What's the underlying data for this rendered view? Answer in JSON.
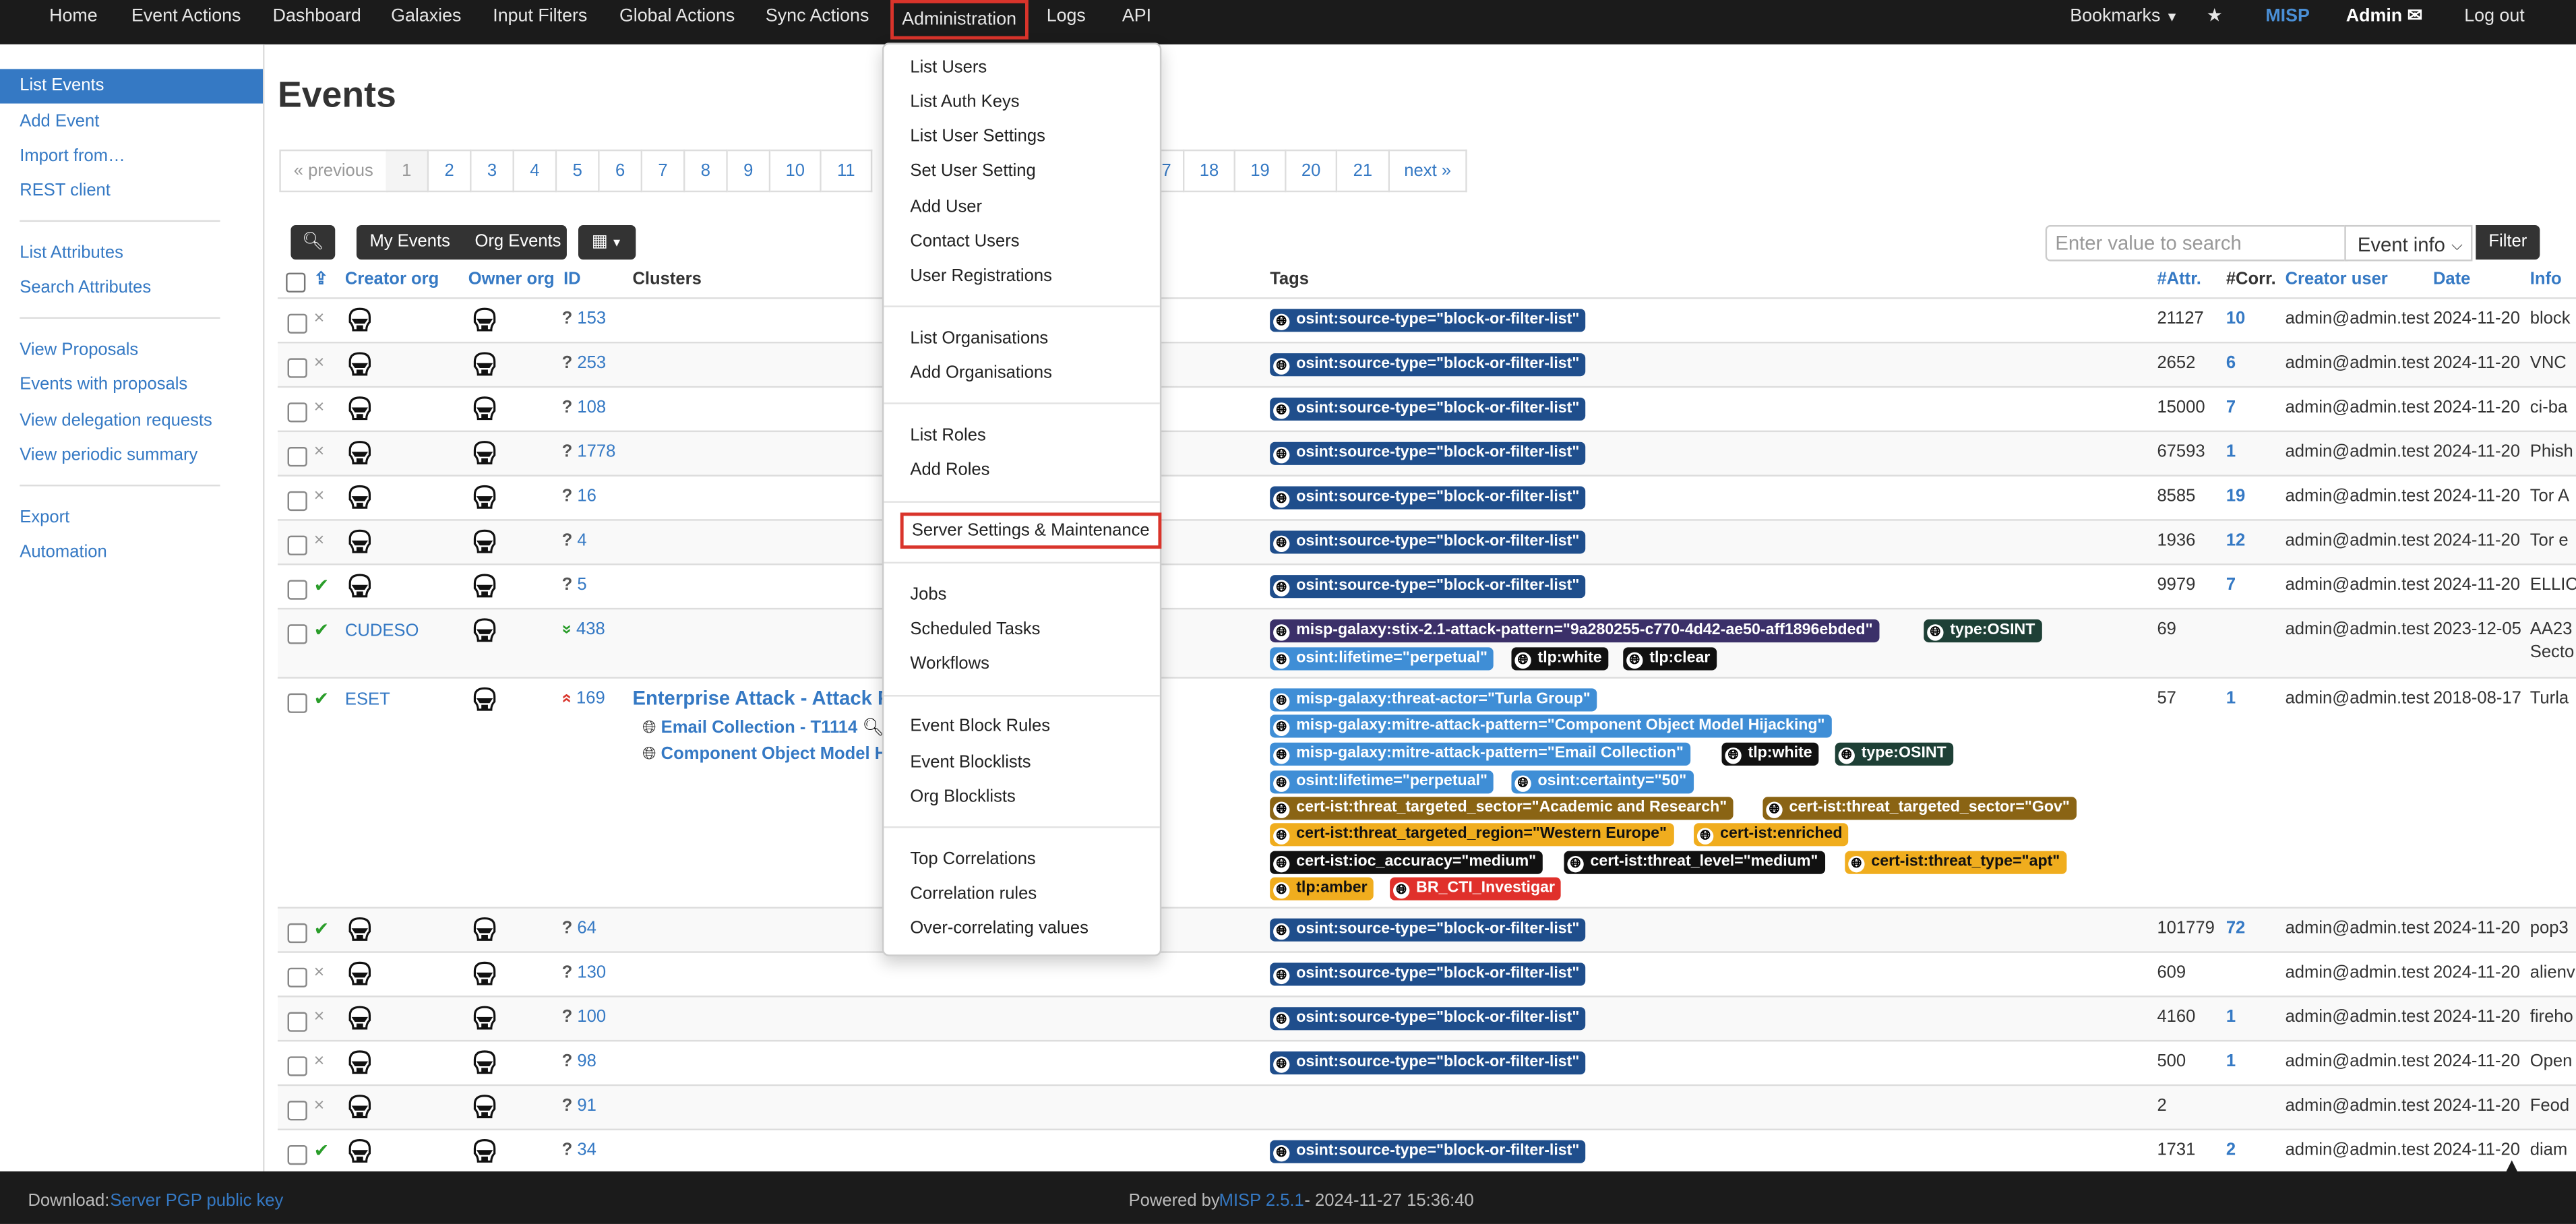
{
  "nav": {
    "items": [
      "Home",
      "Event Actions",
      "Dashboard",
      "Galaxies",
      "Input Filters",
      "Global Actions",
      "Sync Actions",
      "Administration",
      "Logs",
      "API"
    ],
    "bookmarks": "Bookmarks",
    "brand": "MISP",
    "user": "Admin",
    "logout": "Log out"
  },
  "sidebar": {
    "items": [
      "List Events",
      "Add Event",
      "Import from…",
      "REST client",
      "List Attributes",
      "Search Attributes",
      "View Proposals",
      "Events with proposals",
      "View delegation requests",
      "View periodic summary",
      "Export",
      "Automation"
    ]
  },
  "page": {
    "title": "Events"
  },
  "pagination": {
    "prev": "« previous",
    "pages": [
      "1",
      "2",
      "3",
      "4",
      "5",
      "6",
      "7",
      "8",
      "9",
      "10",
      "11"
    ],
    "pages_right": [
      "7",
      "18",
      "19",
      "20",
      "21"
    ],
    "next": "next »"
  },
  "toolbar": {
    "my_events": "My Events",
    "org_events": "Org Events",
    "search_placeholder": "Enter value to search",
    "search_field": "Event info",
    "filter": "Filter"
  },
  "table": {
    "headers": {
      "creator_org": "Creator org",
      "owner_org": "Owner org",
      "id": "ID",
      "clusters": "Clusters",
      "tags": "Tags",
      "attr": "#Attr.",
      "corr": "#Corr.",
      "creator_user": "Creator user",
      "date": "Date",
      "info": "Info"
    },
    "rows": [
      {
        "pub": "×",
        "creator_org": "",
        "id": "153",
        "attr": "21127",
        "corr": "10",
        "user": "admin@admin.test",
        "date": "2024-11-20",
        "info": "block"
      },
      {
        "pub": "×",
        "creator_org": "",
        "id": "253",
        "attr": "2652",
        "corr": "6",
        "user": "admin@admin.test",
        "date": "2024-11-20",
        "info": "VNC"
      },
      {
        "pub": "×",
        "creator_org": "",
        "id": "108",
        "attr": "15000",
        "corr": "7",
        "user": "admin@admin.test",
        "date": "2024-11-20",
        "info": "ci-ba"
      },
      {
        "pub": "×",
        "creator_org": "",
        "id": "1778",
        "attr": "67593",
        "corr": "1",
        "user": "admin@admin.test",
        "date": "2024-11-20",
        "info": "Phish"
      },
      {
        "pub": "×",
        "creator_org": "",
        "id": "16",
        "attr": "8585",
        "corr": "19",
        "user": "admin@admin.test",
        "date": "2024-11-20",
        "info": "Tor A"
      },
      {
        "pub": "×",
        "creator_org": "",
        "id": "4",
        "attr": "1936",
        "corr": "12",
        "user": "admin@admin.test",
        "date": "2024-11-20",
        "info": "Tor e"
      },
      {
        "pub": "✔",
        "creator_org": "",
        "id": "5",
        "attr": "9979",
        "corr": "7",
        "user": "admin@admin.test",
        "date": "2024-11-20",
        "info": "ELLIO"
      },
      {
        "pub": "✔",
        "creator_org": "CUDESO",
        "id": "438",
        "attr": "69",
        "corr": "",
        "user": "admin@admin.test",
        "date": "2023-12-05",
        "info": "AA23",
        "info2": "Secto"
      },
      {
        "pub": "✔",
        "creator_org": "ESET",
        "id": "169",
        "attr": "57",
        "corr": "1",
        "user": "admin@admin.test",
        "date": "2018-08-17",
        "info": "Turla"
      },
      {
        "pub": "✔",
        "creator_org": "",
        "id": "64",
        "attr": "101779",
        "corr": "72",
        "user": "admin@admin.test",
        "date": "2024-11-20",
        "info": "pop3"
      },
      {
        "pub": "×",
        "creator_org": "",
        "id": "130",
        "attr": "609",
        "corr": "",
        "user": "admin@admin.test",
        "date": "2024-11-20",
        "info": "alienv"
      },
      {
        "pub": "×",
        "creator_org": "",
        "id": "100",
        "attr": "4160",
        "corr": "1",
        "user": "admin@admin.test",
        "date": "2024-11-20",
        "info": "fireho"
      },
      {
        "pub": "×",
        "creator_org": "",
        "id": "98",
        "attr": "500",
        "corr": "1",
        "user": "admin@admin.test",
        "date": "2024-11-20",
        "info": "Open"
      },
      {
        "pub": "×",
        "creator_org": "",
        "id": "91",
        "attr": "2",
        "corr": "",
        "user": "admin@admin.test",
        "date": "2024-11-20",
        "info": "Feod"
      },
      {
        "pub": "✔",
        "creator_org": "",
        "id": "34",
        "attr": "1731",
        "corr": "2",
        "user": "admin@admin.test",
        "date": "2024-11-20",
        "info": "diam"
      }
    ],
    "source_tag": "osint:source-type=\"block-or-filter-list\"",
    "cudeso_tags": [
      "misp-galaxy:stix-2.1-attack-pattern=\"9a280255-c770-4d42-ae50-aff1896ebded\"",
      "type:OSINT",
      "osint:lifetime=\"perpetual\"",
      "tlp:white",
      "tlp:clear"
    ],
    "eset_clusters": [
      "Enterprise Attack - Attack P",
      "Email Collection - T1114",
      "Component Object Model Hi"
    ],
    "eset_tags": [
      "misp-galaxy:threat-actor=\"Turla Group\"",
      "misp-galaxy:mitre-attack-pattern=\"Component Object Model Hijacking\"",
      "misp-galaxy:mitre-attack-pattern=\"Email Collection\"",
      "tlp:white",
      "type:OSINT",
      "osint:lifetime=\"perpetual\"",
      "osint:certainty=\"50\"",
      "cert-ist:threat_targeted_sector=\"Academic and Research\"",
      "cert-ist:threat_targeted_sector=\"Gov\"",
      "cert-ist:threat_targeted_region=\"Western Europe\"",
      "cert-ist:enriched",
      "cert-ist:ioc_accuracy=\"medium\"",
      "cert-ist:threat_level=\"medium\"",
      "cert-ist:threat_type=\"apt\"",
      "tlp:amber",
      "BR_CTI_Investigar"
    ]
  },
  "admin_menu": {
    "items": [
      "List Users",
      "List Auth Keys",
      "List User Settings",
      "Set User Setting",
      "Add User",
      "Contact Users",
      "User Registrations",
      "List Organisations",
      "Add Organisations",
      "List Roles",
      "Add Roles",
      "Server Settings & Maintenance",
      "Jobs",
      "Scheduled Tasks",
      "Workflows",
      "Event Block Rules",
      "Event Blocklists",
      "Org Blocklists",
      "Top Correlations",
      "Correlation rules",
      "Over-correlating values"
    ]
  },
  "footer": {
    "download_label": "Download:",
    "download_link": "Server PGP public key",
    "powered_by": "Powered by",
    "misp_version": "MISP 2.5.1",
    "timestamp": "- 2024-11-27 15:36:40"
  },
  "colors": {
    "nav_bg": "#1b1b1b",
    "link": "#3579c4",
    "highlight": "#d9342b",
    "tag_blue": "#1f4e8c",
    "tag_lightblue": "#3f8ed6",
    "tag_black": "#111111",
    "tag_darkgreen": "#1e4036",
    "tag_purple": "#3b3069",
    "tag_orange": "#f0ad1e",
    "tag_brown": "#8a6414",
    "tag_red": "#e0302b"
  }
}
